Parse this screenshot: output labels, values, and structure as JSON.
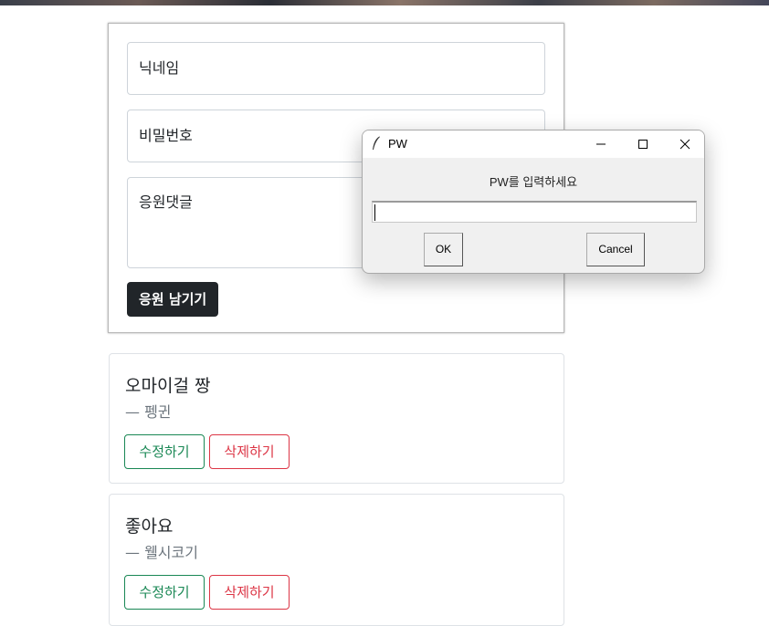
{
  "form": {
    "nickname_placeholder": "닉네임",
    "password_placeholder": "비밀번호",
    "comment_placeholder": "응원댓글",
    "submit_label": "응원 남기기"
  },
  "comments": [
    {
      "text": "오마이걸 짱",
      "author": "— 펭귄",
      "edit_label": "수정하기",
      "delete_label": "삭제하기"
    },
    {
      "text": "좋아요",
      "author": "— 웰시코기",
      "edit_label": "수정하기",
      "delete_label": "삭제하기"
    }
  ],
  "dialog": {
    "title": "PW",
    "prompt": "PW를 입력하세요",
    "input_value": "",
    "ok_label": "OK",
    "cancel_label": "Cancel",
    "icon": "feather-icon"
  },
  "colors": {
    "submit_bg": "#212529",
    "edit_accent": "#198754",
    "delete_accent": "#dc3545"
  }
}
